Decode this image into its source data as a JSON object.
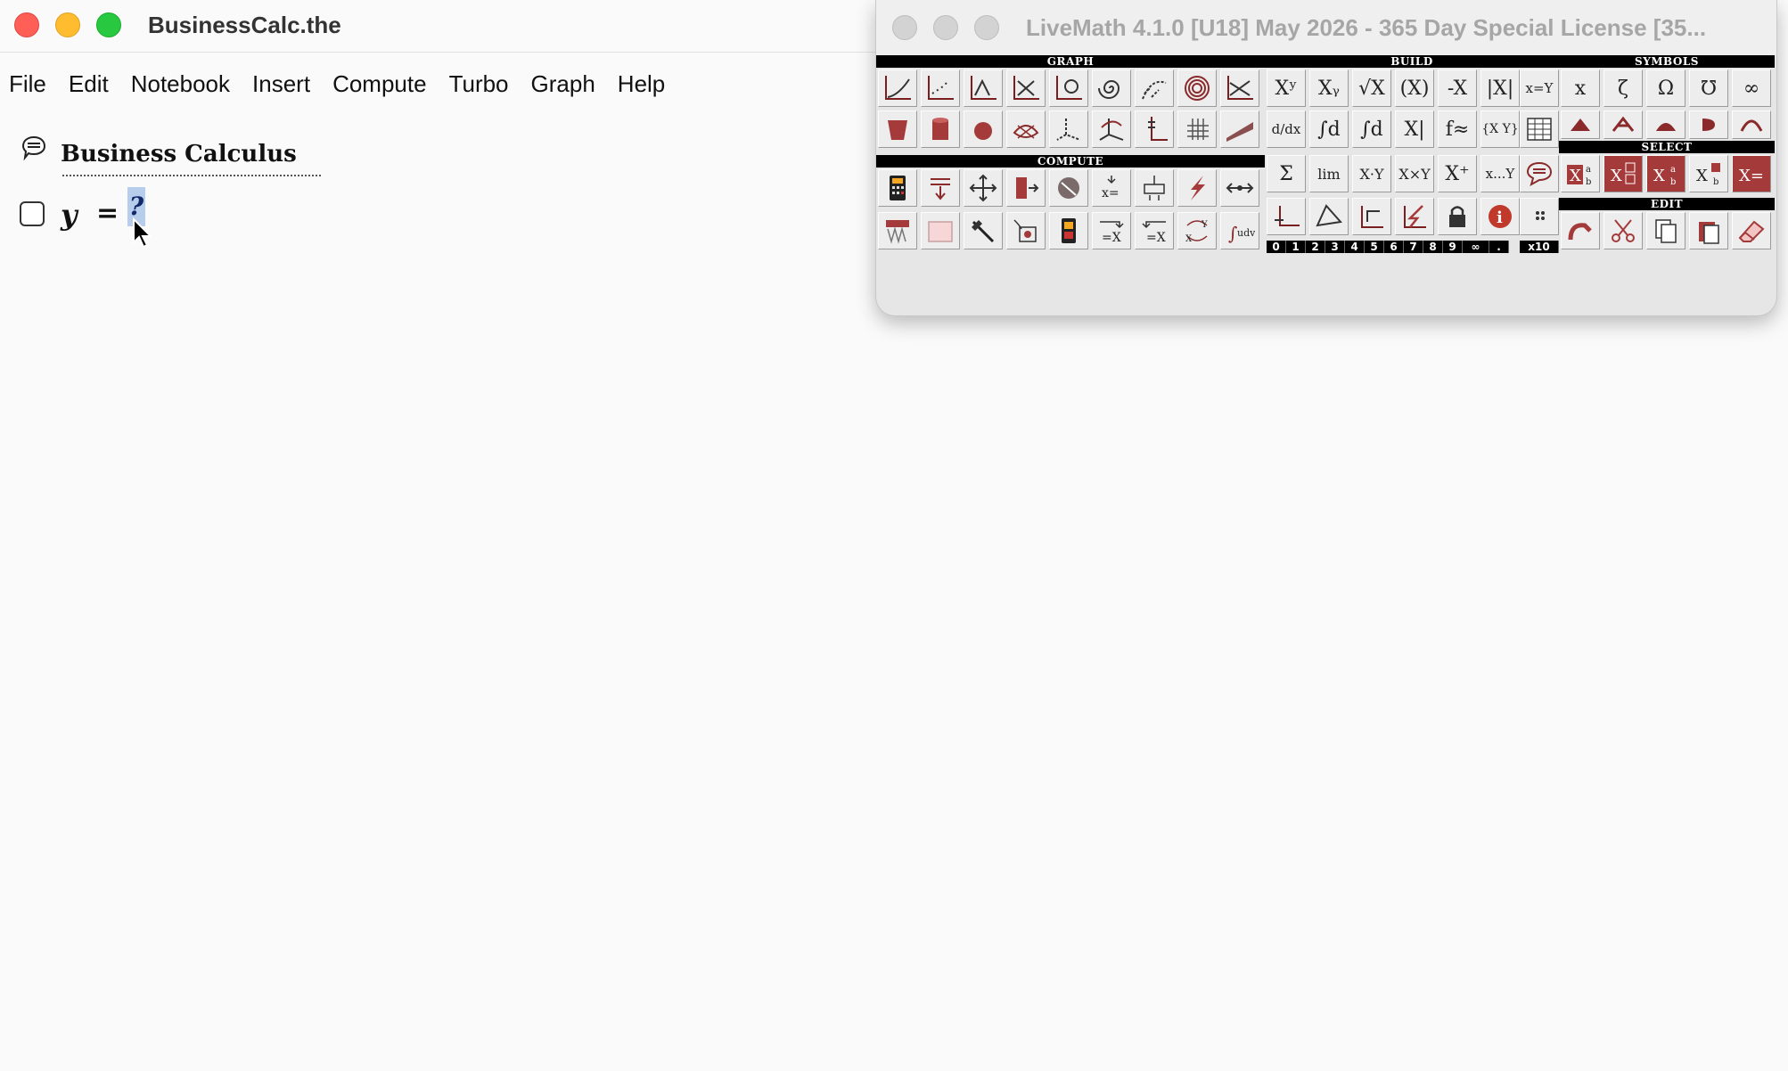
{
  "window": {
    "title": "BusinessCalc.the"
  },
  "menu": [
    "File",
    "Edit",
    "Notebook",
    "Insert",
    "Compute",
    "Turbo",
    "Graph",
    "Help"
  ],
  "notebook": {
    "title": "Business Calculus",
    "equation": {
      "variable": "y",
      "operator": "=",
      "placeholder": "?"
    }
  },
  "palette": {
    "title": "LiveMath 4.1.0 [U18] May 2026 - 365 Day Special License  [35...",
    "sections": {
      "graph": "GRAPH",
      "build": "BUILD",
      "symbols": "SYMBOLS",
      "select": "SELECT",
      "compute": "COMPUTE",
      "edit": "EDIT"
    },
    "build_row1": [
      "Xʸ",
      "Xᵧ",
      "√X",
      "(X)",
      "-X",
      "|X|",
      "x=Y"
    ],
    "build_row2": [
      "d/dx",
      "∫d",
      "∫d",
      "X|",
      "f≈",
      "{X Y}"
    ],
    "build_row3": [
      "Σ",
      "lim",
      "X·Y",
      "X×Y",
      "X⁺",
      "x...Y"
    ],
    "symbols_row1": [
      "x",
      "ζ",
      "Ω",
      "℧",
      "∞"
    ],
    "digits": [
      "0",
      "1",
      "2",
      "3",
      "4",
      "5",
      "6",
      "7",
      "8",
      "9",
      "∞",
      "."
    ],
    "x10_label": "x10"
  },
  "colors": {
    "accent": "#a43a3a",
    "selection": "#b7cdec",
    "close": "#ff5f57",
    "minimize": "#febc2e",
    "zoom": "#28c840"
  }
}
